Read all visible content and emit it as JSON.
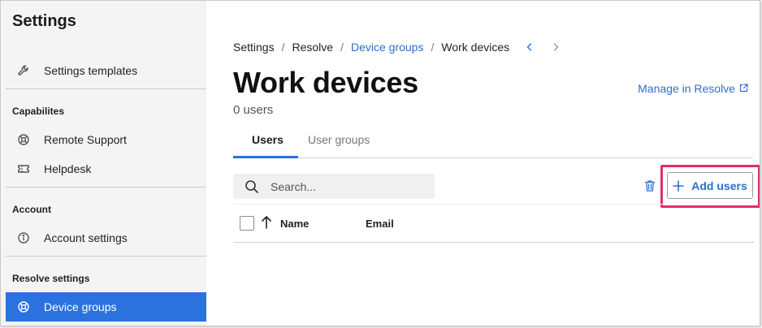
{
  "sidebar": {
    "title": "Settings",
    "items": [
      {
        "label": "Settings templates",
        "icon": "wrench-icon"
      },
      {
        "label": "Remote Support",
        "icon": "lifebuoy-icon"
      },
      {
        "label": "Helpdesk",
        "icon": "ticket-icon"
      },
      {
        "label": "Account settings",
        "icon": "info-icon"
      },
      {
        "label": "Device groups",
        "icon": "lifebuoy-icon",
        "active": true
      }
    ],
    "sections": [
      "Capabilites",
      "Account",
      "Resolve settings"
    ]
  },
  "breadcrumb": {
    "items": [
      "Settings",
      "Resolve",
      "Device groups",
      "Work devices"
    ],
    "separator": "/",
    "link_color": "#2c6fcc"
  },
  "page": {
    "title": "Work devices",
    "subtitle": "0 users",
    "manage_link": "Manage in Resolve"
  },
  "tabs": [
    "Users",
    "User groups"
  ],
  "search": {
    "placeholder": "Search..."
  },
  "toolbar": {
    "add_users_label": "Add users",
    "highlight_color": "#e22d66"
  },
  "table": {
    "columns": [
      "Name",
      "Email"
    ],
    "rows": []
  },
  "colors": {
    "accent": "#2b72de",
    "sidebar_bg": "#f4f4f4"
  }
}
